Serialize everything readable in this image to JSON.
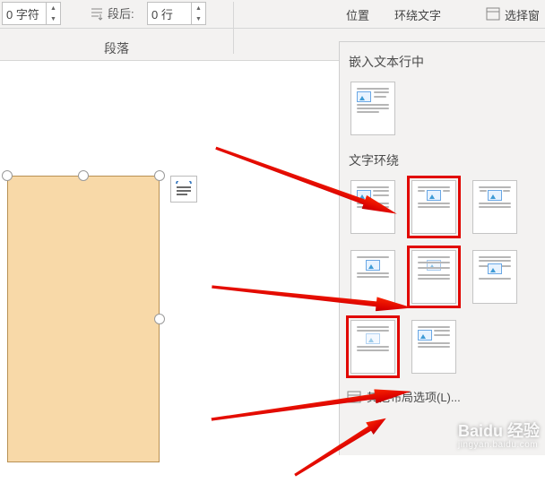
{
  "ribbon": {
    "indent_value": "0 字符",
    "spacing_after_label": "段后:",
    "spacing_after_value": "0 行",
    "group_paragraph": "段落",
    "position_btn": "位置",
    "wrap_text_btn": "环绕文字",
    "select_pane_btn": "选择窗"
  },
  "panel": {
    "section_inline": "嵌入文本行中",
    "section_wrap": "文字环绕",
    "more_options": "其他布局选项(L)..."
  },
  "thumbs": {
    "inline": [
      {
        "name": "in-line-with-text"
      }
    ],
    "wrap": [
      {
        "name": "square",
        "selected": false
      },
      {
        "name": "tight",
        "selected": true
      },
      {
        "name": "through",
        "selected": false
      },
      {
        "name": "top-and-bottom",
        "selected": false
      },
      {
        "name": "behind-text",
        "selected": true
      },
      {
        "name": "in-front-of-text",
        "selected": false
      },
      {
        "name": "edit-wrap-points",
        "selected": true
      },
      {
        "name": "edit-wrap-points-2",
        "selected": false
      }
    ]
  },
  "watermark": {
    "brand": "Baidu 经验",
    "url": "jingyan.baidu.com"
  }
}
